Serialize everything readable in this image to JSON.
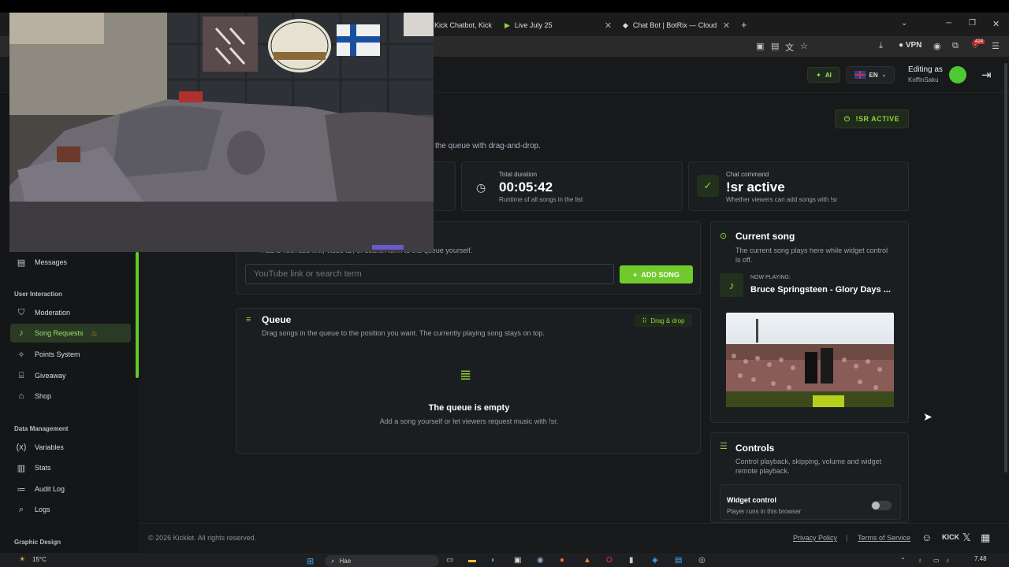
{
  "browser": {
    "tabs": [
      {
        "label": "Kick Chatbot, Kick"
      },
      {
        "label": "Live July 25"
      },
      {
        "label": "Chat Bot | BotRix — Cloud Strea"
      }
    ],
    "vpn_label": "VPN",
    "badge_count": "424"
  },
  "header": {
    "ai_label": "AI",
    "lang_label": "EN",
    "editing_as_label": "Editing as",
    "username": "KoffinSaku"
  },
  "page": {
    "status_badge": "!SR ACTIVE",
    "description_fragment": "the queue with drag-and-drop."
  },
  "stats": [
    {
      "label": "Total duration",
      "value": "00:05:42",
      "sub": "Runtime of all songs in the list"
    },
    {
      "label": "Chat command",
      "value": "!sr active",
      "sub": "Whether viewers can add songs with !sr"
    }
  ],
  "add_song": {
    "hint_fragment": "Add a YouTube link, video ID, or search term to the queue yourself.",
    "placeholder": "YouTube link or search term",
    "button_label": "ADD SONG"
  },
  "queue": {
    "title": "Queue",
    "subtitle": "Drag songs in the queue to the position you want. The currently playing song stays on top.",
    "drag_badge": "Drag & drop",
    "empty_title": "The queue is empty",
    "empty_sub": "Add a song yourself or let viewers request music with !sr."
  },
  "current_song": {
    "title": "Current song",
    "subtitle": "The current song plays here while widget control is off.",
    "now_playing_label": "NOW PLAYING:",
    "song_title": "Bruce Springsteen - Glory Days ..."
  },
  "controls": {
    "title": "Controls",
    "subtitle": "Control playback, skipping, volume and widget remote playback.",
    "widget_label": "Widget control",
    "widget_sub": "Player runs in this browser"
  },
  "sidebar": {
    "messages": "Messages",
    "section_user": "User Interaction",
    "items_user": [
      {
        "label": "Moderation",
        "icon": "shield-icon"
      },
      {
        "label": "Song Requests",
        "icon": "music-note-icon"
      },
      {
        "label": "Points System",
        "icon": "sparkle-icon"
      },
      {
        "label": "Giveaway",
        "icon": "gift-icon"
      },
      {
        "label": "Shop",
        "icon": "store-icon"
      }
    ],
    "section_data": "Data Management",
    "items_data": [
      {
        "label": "Variables",
        "icon": "variable-icon"
      },
      {
        "label": "Stats",
        "icon": "chart-icon"
      },
      {
        "label": "Audit Log",
        "icon": "audit-log-icon"
      },
      {
        "label": "Logs",
        "icon": "logs-icon"
      }
    ],
    "section_design": "Graphic Design"
  },
  "footer": {
    "copyright": "© 2026 Kicklet. All rights reserved.",
    "privacy": "Privacy Policy",
    "separator": "|",
    "terms": "Terms of Service"
  },
  "taskbar": {
    "weather_temp": "15°C",
    "search_placeholder": "Hae",
    "time": "7.48"
  },
  "colors": {
    "accent": "#6fca2b",
    "background": "#17191b"
  }
}
